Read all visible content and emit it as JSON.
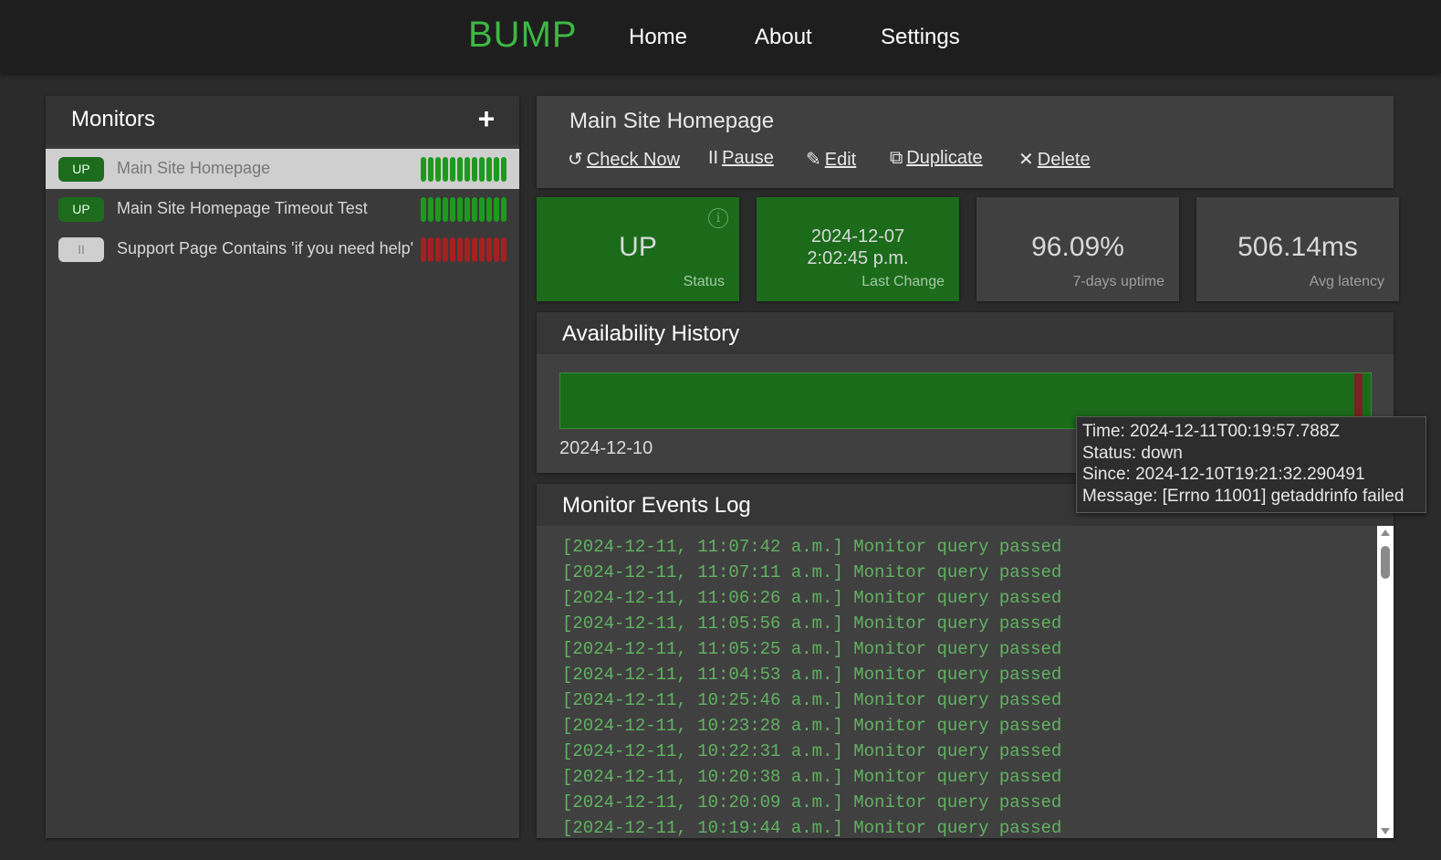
{
  "nav": {
    "brand": "BUMP",
    "links": [
      "Home",
      "About",
      "Settings"
    ]
  },
  "sidebar": {
    "title": "Monitors",
    "add_label": "+",
    "monitors": [
      {
        "badge": "UP",
        "state": "up",
        "name": "Main Site Homepage",
        "selected": true,
        "history": [
          "up",
          "up",
          "up",
          "up",
          "up",
          "up",
          "up",
          "up",
          "up",
          "up",
          "up",
          "up"
        ]
      },
      {
        "badge": "UP",
        "state": "up",
        "name": "Main Site Homepage Timeout Test",
        "selected": false,
        "history": [
          "up",
          "up",
          "up",
          "up",
          "up",
          "up",
          "up",
          "up",
          "up",
          "up",
          "up",
          "up"
        ]
      },
      {
        "badge": "II",
        "state": "paused",
        "name": "Support Page Contains 'if you need help'",
        "selected": false,
        "history": [
          "down",
          "down",
          "down",
          "down",
          "down",
          "down",
          "down",
          "down",
          "down",
          "down",
          "down",
          "down"
        ]
      }
    ]
  },
  "detail": {
    "title": "Main Site Homepage",
    "actions": [
      {
        "icon": "↺",
        "label": "Check Now"
      },
      {
        "icon": "II",
        "label": "Pause"
      },
      {
        "icon": "✎",
        "label": "Edit"
      },
      {
        "icon": "⧉",
        "label": "Duplicate"
      },
      {
        "icon": "✕",
        "label": "Delete"
      }
    ]
  },
  "stats": {
    "status": {
      "value": "UP",
      "label": "Status",
      "info_icon": "i"
    },
    "last_change": {
      "date": "2024-12-07",
      "time": "2:02:45 p.m.",
      "label": "Last Change"
    },
    "uptime": {
      "value": "96.09%",
      "label": "7-days uptime"
    },
    "latency": {
      "value": "506.14ms",
      "label": "Avg latency"
    }
  },
  "availability": {
    "title": "Availability History",
    "date_label": "2024-12-10"
  },
  "tooltip": {
    "time": "Time: 2024-12-11T00:19:57.788Z",
    "status": "Status: down",
    "since": "Since: 2024-12-10T19:21:32.290491",
    "message": "Message: [Errno 11001] getaddrinfo failed"
  },
  "events": {
    "title": "Monitor Events Log",
    "lines": [
      "[2024-12-11, 11:07:42 a.m.] Monitor query passed",
      "[2024-12-11, 11:07:11 a.m.] Monitor query passed",
      "[2024-12-11, 11:06:26 a.m.] Monitor query passed",
      "[2024-12-11, 11:05:56 a.m.] Monitor query passed",
      "[2024-12-11, 11:05:25 a.m.] Monitor query passed",
      "[2024-12-11, 11:04:53 a.m.] Monitor query passed",
      "[2024-12-11, 10:25:46 a.m.] Monitor query passed",
      "[2024-12-11, 10:23:28 a.m.] Monitor query passed",
      "[2024-12-11, 10:22:31 a.m.] Monitor query passed",
      "[2024-12-11, 10:20:38 a.m.] Monitor query passed",
      "[2024-12-11, 10:20:09 a.m.] Monitor query passed",
      "[2024-12-11, 10:19:44 a.m.] Monitor query passed"
    ]
  },
  "colors": {
    "brand": "#3db843",
    "up": "#1d9a1d",
    "down": "#a52020",
    "log_text": "#61b261"
  }
}
